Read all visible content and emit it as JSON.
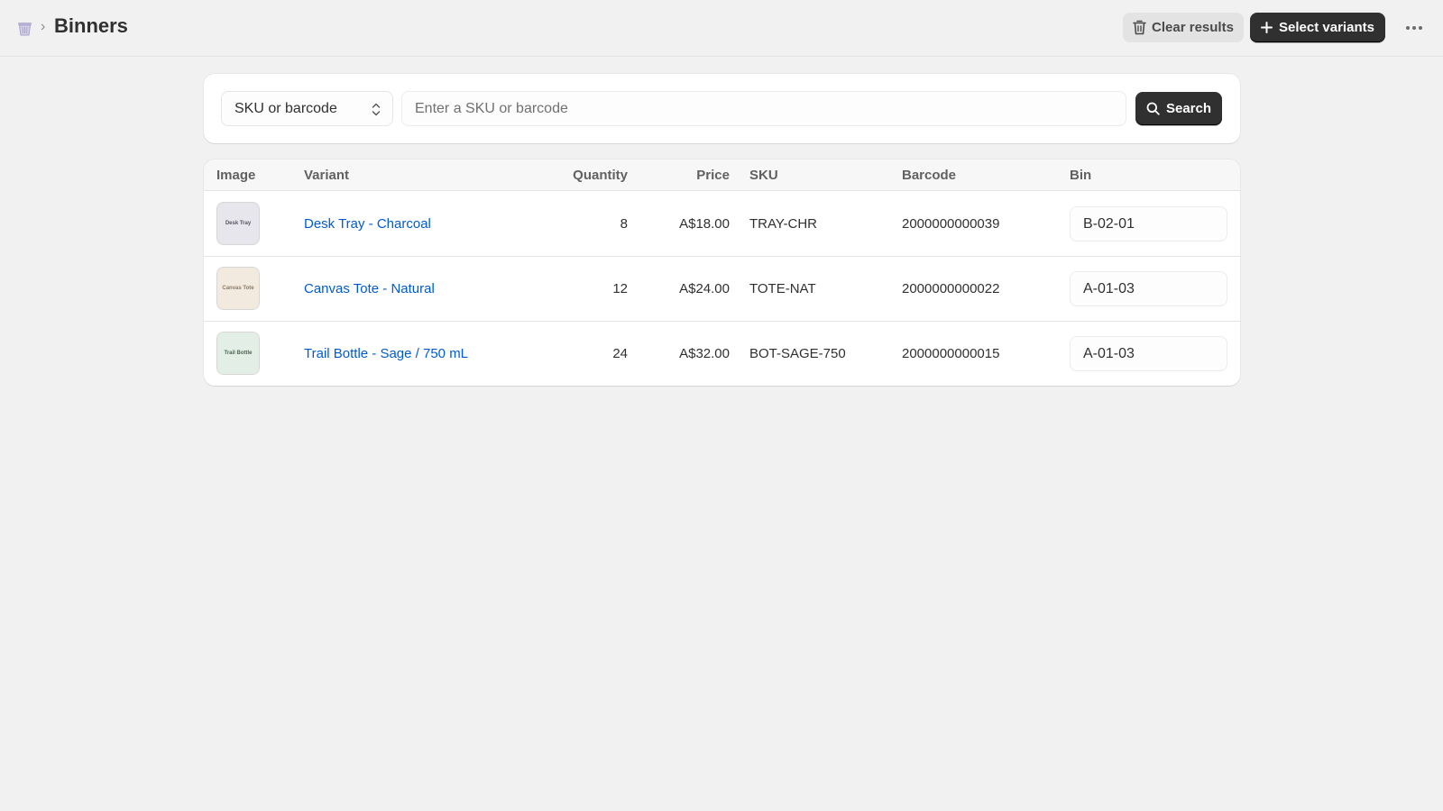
{
  "header": {
    "title": "Binners",
    "separator": "›",
    "clear_label": "Clear results",
    "select_label": "Select variants"
  },
  "search": {
    "type_value": "SKU or barcode",
    "placeholder": "Enter a SKU or barcode",
    "button_label": "Search"
  },
  "table": {
    "columns": {
      "image": "Image",
      "variant": "Variant",
      "quantity": "Quantity",
      "price": "Price",
      "sku": "SKU",
      "barcode": "Barcode",
      "bin": "Bin"
    },
    "rows": [
      {
        "thumb_text": "Desk Tray",
        "thumb_bg": "#e6e6ec",
        "thumb_fg": "#555566",
        "variant": "Desk Tray - Charcoal",
        "quantity": "8",
        "price": "A$18.00",
        "sku": "TRAY-CHR",
        "barcode": "2000000000039",
        "bin": "B-02-01"
      },
      {
        "thumb_text": "Canvas Tote",
        "thumb_bg": "#f3eadf",
        "thumb_fg": "#8a7a66",
        "variant": "Canvas Tote - Natural",
        "quantity": "12",
        "price": "A$24.00",
        "sku": "TOTE-NAT",
        "barcode": "2000000000022",
        "bin": "A-01-03"
      },
      {
        "thumb_text": "Trail Bottle",
        "thumb_bg": "#e3efe6",
        "thumb_fg": "#4c6652",
        "variant": "Trail Bottle - Sage / 750 mL",
        "quantity": "24",
        "price": "A$32.00",
        "sku": "BOT-SAGE-750",
        "barcode": "2000000000015",
        "bin": "A-01-03"
      }
    ]
  },
  "colors": {
    "background": "#f1f1f1",
    "primary_button": "#303030",
    "link": "#005bd3"
  }
}
